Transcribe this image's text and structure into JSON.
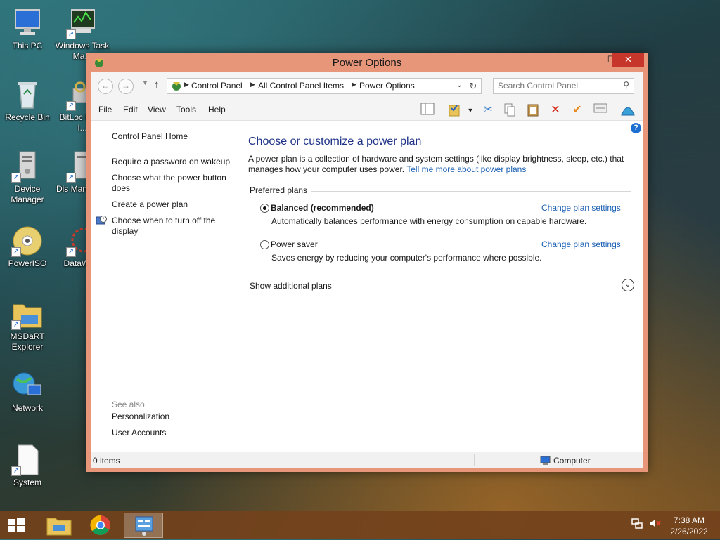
{
  "desktop": {
    "icons": [
      {
        "label": "This PC"
      },
      {
        "label": "Windows Task Ma..."
      },
      {
        "label": "Recycle Bin"
      },
      {
        "label": "BitLoc Drive I..."
      },
      {
        "label": "Device Manager"
      },
      {
        "label": "Dis Manage..."
      },
      {
        "label": "PowerISO"
      },
      {
        "label": "DataWa..."
      },
      {
        "label": "MSDaRT Explorer"
      },
      {
        "label": "Network"
      },
      {
        "label": "System"
      }
    ]
  },
  "window": {
    "title": "Power Options",
    "controls": {
      "minimize": "—",
      "maximize": "☐",
      "close": "✕"
    }
  },
  "address_bar": {
    "crumbs": [
      "Control Panel",
      "All Control Panel Items",
      "Power Options"
    ]
  },
  "search": {
    "placeholder": "Search Control Panel"
  },
  "menu": [
    "File",
    "Edit",
    "View",
    "Tools",
    "Help"
  ],
  "left_nav": {
    "home": "Control Panel Home",
    "links": [
      "Require a password on wakeup",
      "Choose what the power button does",
      "Create a power plan",
      "Choose when to turn off the display"
    ],
    "see_also_label": "See also",
    "see_also": [
      "Personalization",
      "User Accounts"
    ]
  },
  "main": {
    "heading": "Choose or customize a power plan",
    "description": "A power plan is a collection of hardware and system settings (like display brightness, sleep, etc.) that manages how your computer uses power.",
    "learn_more": "Tell me more about power plans",
    "preferred_label": "Preferred plans",
    "plans": [
      {
        "name": "Balanced (recommended)",
        "description": "Automatically balances performance with energy consumption on capable hardware.",
        "link": "Change plan settings",
        "selected": true
      },
      {
        "name": "Power saver",
        "description": "Saves energy by reducing your computer's performance where possible.",
        "link": "Change plan settings",
        "selected": false
      }
    ],
    "additional_label": "Show additional plans"
  },
  "statusbar": {
    "items": "0 items",
    "zone": "Computer"
  },
  "taskbar": {
    "time": "7:38 AM",
    "date": "2/26/2022"
  },
  "colors": {
    "window_frame": "#e8967a",
    "close_button": "#c7362b",
    "link": "#1a5fb4",
    "heading": "#1e3287"
  }
}
